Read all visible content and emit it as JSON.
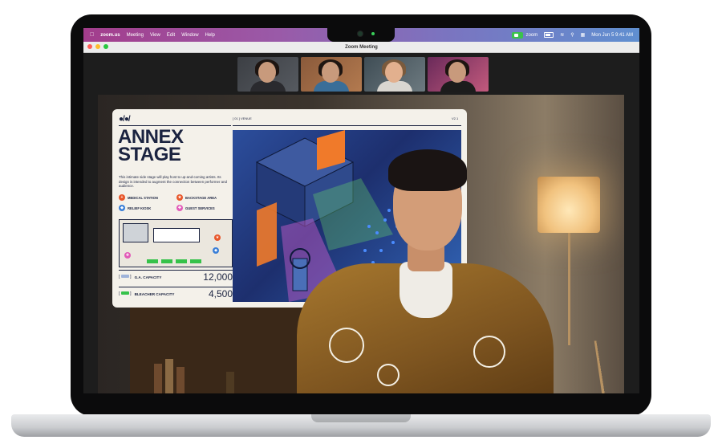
{
  "menubar": {
    "app_name": "zoom.us",
    "menus": [
      "Meeting",
      "View",
      "Edit",
      "Window",
      "Help"
    ],
    "status_app": "zoom",
    "datetime": "Mon Jun 5  9:41 AM"
  },
  "window": {
    "title": "Zoom Meeting"
  },
  "slide": {
    "logo": "●/●/",
    "section": "[ 01 ] VENUE",
    "version": "V2.1",
    "title": "ANNEX STAGE",
    "description": "This intimate side stage will play host to up-and-coming artists. Its design is intended to augment the connection between performer and audience.",
    "legend": [
      {
        "label": "MEDICAL STATION",
        "color": "#e8562a",
        "glyph": "+"
      },
      {
        "label": "BACKSTAGE AREA",
        "color": "#e8562a",
        "glyph": "★"
      },
      {
        "label": "RELIEF KIOSK",
        "color": "#3a7fd8",
        "glyph": "◆"
      },
      {
        "label": "GUEST SERVICES",
        "color": "#e25bb8",
        "glyph": "✚"
      }
    ],
    "capacities": [
      {
        "label": "G.A. CAPACITY",
        "value": "12,000",
        "swatch": "#9fb3d9"
      },
      {
        "label": "BLEACHER CAPACITY",
        "value": "4,500",
        "swatch": "#36c24a"
      }
    ]
  },
  "colors": {
    "zoom_green": "#28c840",
    "menubar_gradient_start": "#a33d8c",
    "menubar_gradient_end": "#5f8fd0",
    "slide_ink": "#1b2340"
  }
}
